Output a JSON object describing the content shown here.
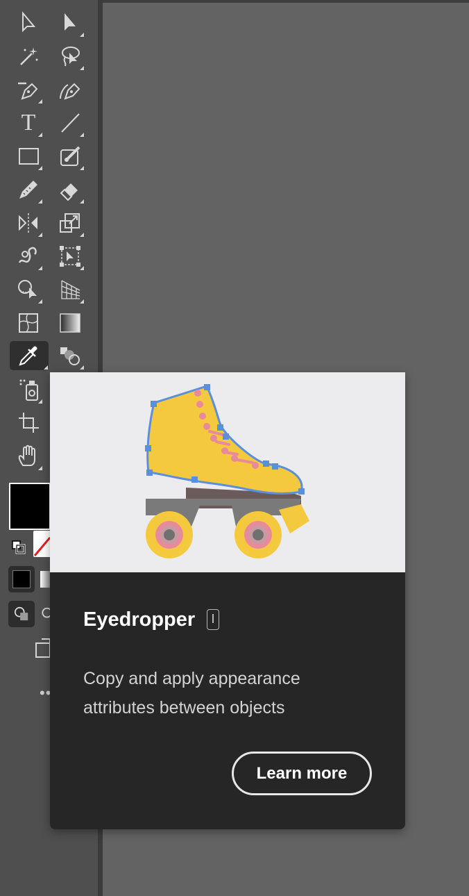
{
  "toolbar": {
    "tools": [
      {
        "name": "selection-tool",
        "icon": "selection-arrow-icon"
      },
      {
        "name": "direct-selection-tool",
        "icon": "direct-selection-arrow-icon"
      },
      {
        "name": "magic-wand-tool",
        "icon": "magic-wand-icon"
      },
      {
        "name": "lasso-tool",
        "icon": "lasso-icon"
      },
      {
        "name": "pen-tool",
        "icon": "pen-icon"
      },
      {
        "name": "curvature-tool",
        "icon": "curvature-pen-icon"
      },
      {
        "name": "type-tool",
        "icon": "type-icon",
        "glyph": "T"
      },
      {
        "name": "line-segment-tool",
        "icon": "line-segment-icon"
      },
      {
        "name": "rectangle-tool",
        "icon": "rectangle-icon"
      },
      {
        "name": "shaper-tool",
        "icon": "shaper-brush-icon"
      },
      {
        "name": "pencil-tool",
        "icon": "pencil-icon"
      },
      {
        "name": "eraser-tool",
        "icon": "eraser-icon"
      },
      {
        "name": "reflect-tool",
        "icon": "reflect-icon"
      },
      {
        "name": "scale-tool",
        "icon": "scale-icon"
      },
      {
        "name": "warp-tool",
        "icon": "warp-icon"
      },
      {
        "name": "free-transform-tool",
        "icon": "free-transform-icon"
      },
      {
        "name": "shape-builder-tool",
        "icon": "shape-builder-icon"
      },
      {
        "name": "perspective-grid-tool",
        "icon": "perspective-grid-icon"
      },
      {
        "name": "mesh-tool",
        "icon": "mesh-icon"
      },
      {
        "name": "gradient-tool",
        "icon": "gradient-icon"
      },
      {
        "name": "eyedropper-tool",
        "icon": "eyedropper-icon",
        "active": true
      },
      {
        "name": "blend-tool",
        "icon": "blend-icon"
      },
      {
        "name": "symbol-sprayer-tool",
        "icon": "symbol-sprayer-icon"
      },
      {
        "name": "artboard-tool",
        "icon": "artboard-icon"
      },
      {
        "name": "hand-tool",
        "icon": "hand-icon"
      }
    ],
    "fill_color": "#000000",
    "stroke_color": "none",
    "more_glyph": "•••"
  },
  "tooltip": {
    "title": "Eyedropper",
    "shortcut": "I",
    "description": "Copy and apply appearance attributes between objects",
    "learn_more_label": "Learn more",
    "illustration": "roller-skate-illustration"
  },
  "colors": {
    "toolbar_bg": "#4f4f4f",
    "canvas_bg": "#636363",
    "tooltip_bg": "#262626",
    "illustration_bg": "#ececee",
    "skate_yellow": "#f5c93e",
    "skate_anchor_blue": "#5b8fdb",
    "skate_lace_pink": "#e88a9c"
  }
}
